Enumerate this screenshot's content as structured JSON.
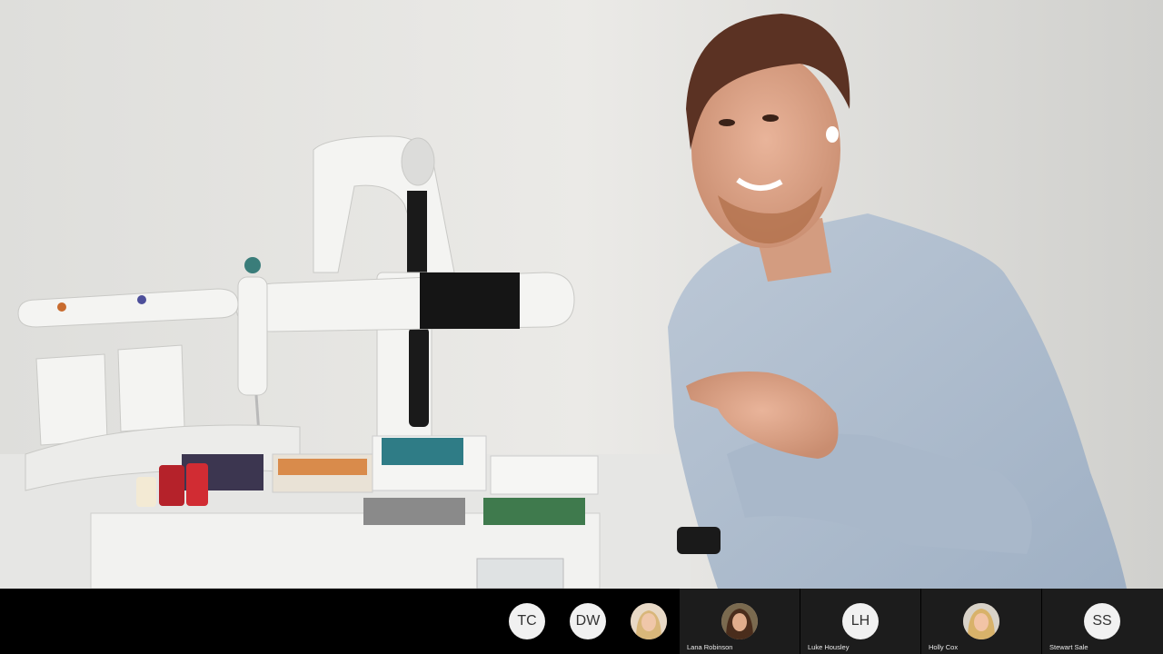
{
  "main_video": {
    "description_icon": "speaker-video"
  },
  "participants_compact": [
    {
      "initials": "TC",
      "type": "initials"
    },
    {
      "initials": "DW",
      "type": "initials"
    },
    {
      "initials": "",
      "type": "photo"
    }
  ],
  "participants_tiles": [
    {
      "initials": "",
      "type": "photo",
      "name": "Lana Robinson"
    },
    {
      "initials": "LH",
      "type": "initials",
      "name": "Luke Housley"
    },
    {
      "initials": "",
      "type": "photo",
      "name": "Holly Cox"
    },
    {
      "initials": "SS",
      "type": "initials",
      "name": "Stewart Sale"
    }
  ],
  "colors": {
    "strip_bg": "#000000",
    "tile_bg": "#1c1c1c",
    "avatar_bg": "#f1f1f1"
  }
}
